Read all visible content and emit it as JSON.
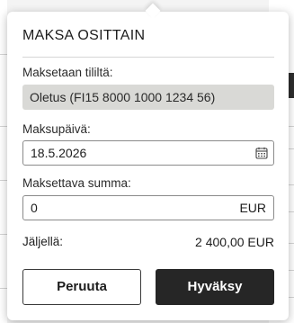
{
  "dialog": {
    "title": "MAKSA OSITTAIN",
    "account_label": "Maksetaan tililtä:",
    "account_value": "Oletus (FI15 8000 1000 1234 56)",
    "date_label": "Maksupäivä:",
    "date_value": "18.5.2026",
    "amount_label": "Maksettava summa:",
    "amount_value": "0",
    "amount_currency": "EUR",
    "remaining_label": "Jäljellä:",
    "remaining_value": "2 400,00 EUR",
    "cancel_label": "Peruuta",
    "accept_label": "Hyväksy"
  },
  "icons": {
    "date": "calendar-icon"
  },
  "colors": {
    "primary_button": "#262626",
    "readonly_field": "#d9d9d6"
  }
}
